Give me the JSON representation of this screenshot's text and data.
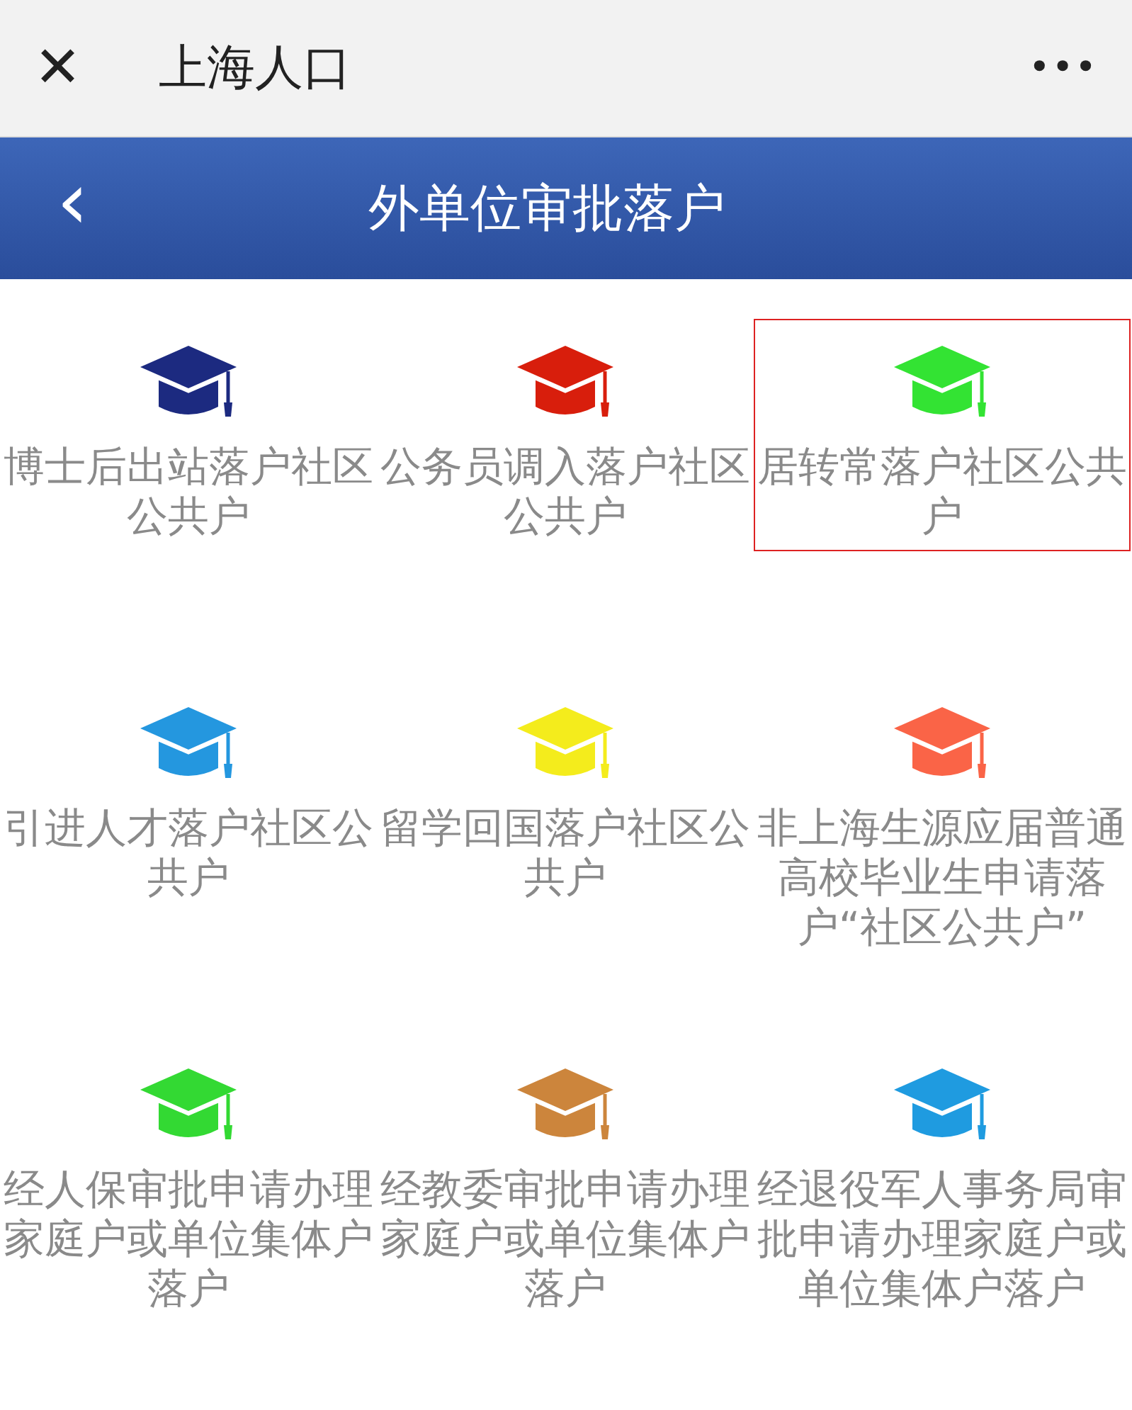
{
  "window": {
    "title": "上海人口",
    "close": "✕",
    "more": "•••"
  },
  "header": {
    "back": "‹",
    "title": "外单位审批落户"
  },
  "items": [
    {
      "label": "博士后出站落户社区公共户",
      "color": "#1c2a80",
      "selected": false
    },
    {
      "label": "公务员调入落户社区公共户",
      "color": "#d81e0c",
      "selected": false
    },
    {
      "label": "居转常落户社区公共户",
      "color": "#33e333",
      "selected": true
    },
    {
      "label": "引进人才落户社区公共户",
      "color": "#2497df",
      "selected": false
    },
    {
      "label": "留学回国落户社区公共户",
      "color": "#f4ec1c",
      "selected": false
    },
    {
      "label": "非上海生源应届普通高校毕业生申请落户“社区公共户”",
      "color": "#fa6447",
      "selected": false
    },
    {
      "label": "经人保审批申请办理家庭户或单位集体户落户",
      "color": "#33d933",
      "selected": false
    },
    {
      "label": "经教委审批申请办理家庭户或单位集体户落户",
      "color": "#cc853c",
      "selected": false
    },
    {
      "label": "经退役军人事务局审批申请办理家庭户或单位集体户落户",
      "color": "#1f9be0",
      "selected": false
    }
  ]
}
